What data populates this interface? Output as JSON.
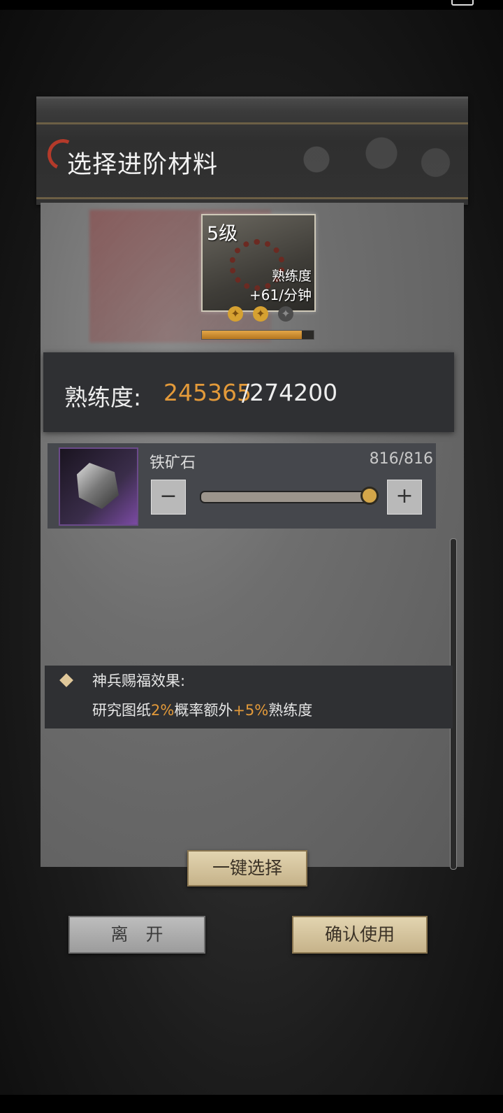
{
  "dialog": {
    "title": "选择进阶材料"
  },
  "item": {
    "level": "5级",
    "proficiency_label": "熟练度",
    "rate": "+61/分钟",
    "progress": 0.895
  },
  "stats": {
    "label": "熟练度:",
    "current": "245365",
    "total": "/274200"
  },
  "material": {
    "name": "铁矿石",
    "count": "816/816",
    "minus": "−",
    "plus": "+",
    "slider_value": 1.0
  },
  "blessing": {
    "title": "神兵赐福效果:",
    "line_prefix": "研究图纸",
    "pct1": "2%",
    "line_mid": "概率额外",
    "pct2": "+5%",
    "line_suffix": "熟练度"
  },
  "buttons": {
    "auto_select": "一键选择",
    "leave": "离　开",
    "confirm": "确认使用"
  }
}
